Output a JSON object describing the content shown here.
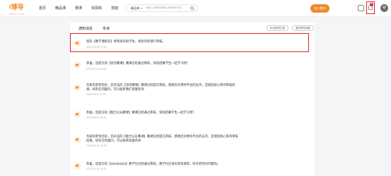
{
  "header": {
    "logo_text": "i博导",
    "logo_sub": "IBODAO.COM",
    "nav": [
      "首页",
      "精品课",
      "赛课",
      "资源库",
      "技能"
    ],
    "search_category": "精品课",
    "search_placeholder": "请输入搜索的课程名称/教师/学校",
    "join_label": "加入教学",
    "notification_count": "1"
  },
  "tabs": {
    "active": "通知消息",
    "other": "未读"
  },
  "actions": {
    "mark_all_read": "标记所有已读",
    "clear_all": "清空所有消息"
  },
  "messages": [
    {
      "text": "您的【教学课程包】即将发布给学生，请您尽快进行审核。",
      "time": "2022-06-06 17:58"
    },
    {
      "text": "恭喜，您提交的【双创赛课】赛课已经通过审核，快快招募学生一起学习吧！",
      "time": "2022-05-26 13:08"
    },
    {
      "text": "亲爱的老师您好，您开设的【双创赛课】赛课已经提交审核，感谢您对博导平台的支持，还请您耐心等待审核结果。如有任何疑问，可以联系我们客服咨询",
      "time": "2022-05-26 11:09"
    },
    {
      "text": "恭喜，您提交的【能力认证赛课】赛课已经通过审核，快快招募学生一起学习吧！",
      "time": "2022-05-25 18:46"
    },
    {
      "text": "亲爱的老师您好，您开设的【能力认证赛课】赛课已经提交审核，感谢您对博导平台的支持，还请您耐心等待审核结果。如有任何疑问，可以联系客服咨询",
      "time": "2022-05-25 18:46"
    },
    {
      "text": "恭喜，您提交的【333333333】教学包已经通过审核，教学包已发布到资源库，所有老师均可看到。",
      "time": "2022-05-16 14:43"
    }
  ]
}
